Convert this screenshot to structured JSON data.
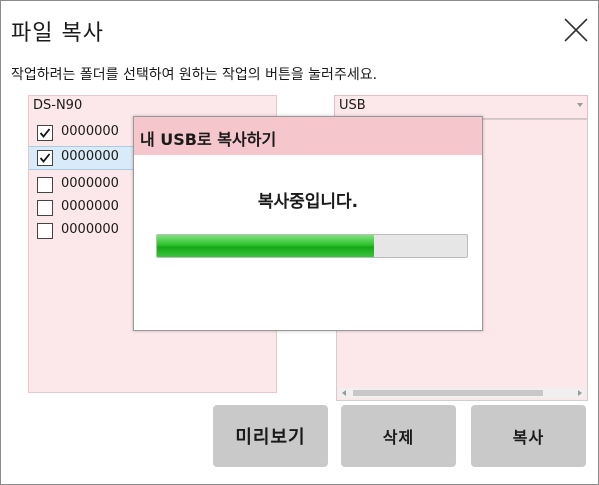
{
  "window": {
    "title": "파일 복사",
    "close_icon": "close-icon"
  },
  "instruction": "작업하려는 폴더를 선택하여 원하는 작업의 버튼을 눌러주세요.",
  "left_panel": {
    "header": "DS-N90",
    "items": [
      {
        "label": "0000000",
        "checked": true,
        "selected": false
      },
      {
        "label": "0000000",
        "checked": true,
        "selected": true
      },
      {
        "label": "0000000",
        "checked": false,
        "selected": false
      },
      {
        "label": "0000000",
        "checked": false,
        "selected": false
      },
      {
        "label": "0000000",
        "checked": false,
        "selected": false
      }
    ]
  },
  "right_panel": {
    "dropdown_value": "USB"
  },
  "buttons": {
    "preview": "미리보기",
    "delete": "삭제",
    "copy": "복사"
  },
  "dialog": {
    "title": "내 USB로 복사하기",
    "message": "복사중입니다.",
    "progress_percent": 70
  },
  "colors": {
    "panel_pink": "#fce8ea",
    "dialog_header": "#f5c7cc",
    "progress_green": "#1fb51f",
    "button_gray": "#c9c9c9"
  }
}
